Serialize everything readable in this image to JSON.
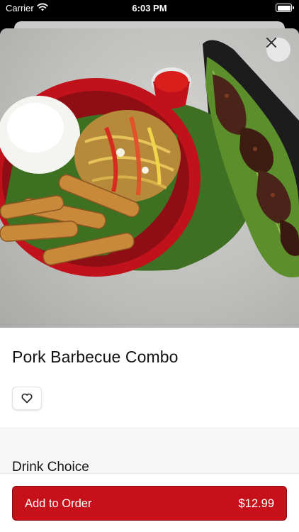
{
  "status_bar": {
    "carrier": "Carrier",
    "time": "6:03 PM",
    "wifi_icon": "wifi-icon",
    "battery_icon": "battery-icon",
    "battery_level": 1.0
  },
  "item": {
    "title": "Pork Barbecue Combo",
    "image_alt": "Plate with rice, pancit noodles, lumpia and barbecue pork skewers on banana leaf",
    "favorite_icon": "heart-icon",
    "close_icon": "close-icon"
  },
  "options": {
    "section_title": "Drink Choice"
  },
  "order": {
    "add_label": "Add to Order",
    "price": "$12.99"
  },
  "colors": {
    "accent": "#c6111b",
    "accent_border": "#8e0910",
    "background": "#ffffff",
    "section_bg": "#f6f6f6"
  }
}
